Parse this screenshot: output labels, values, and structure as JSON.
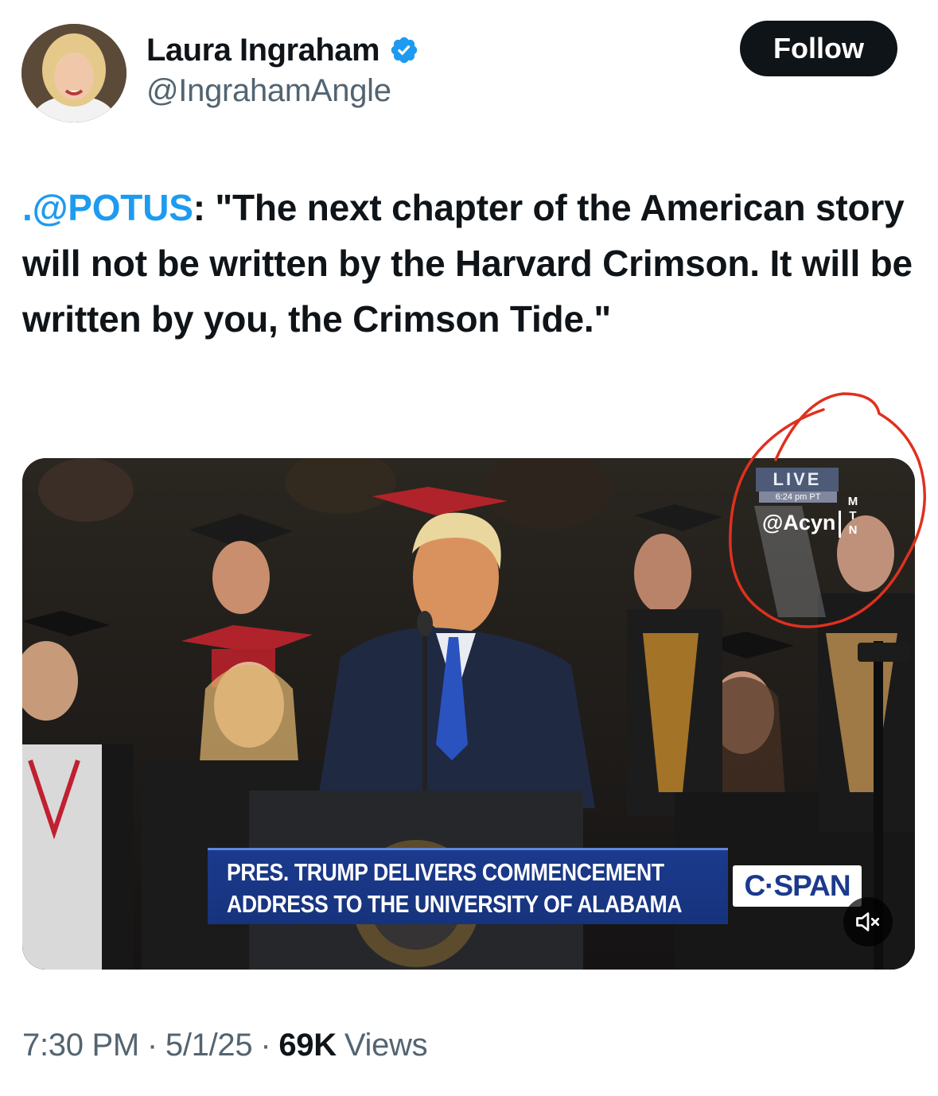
{
  "author": {
    "display_name": "Laura Ingraham",
    "handle": "@IngrahamAngle",
    "verified": true,
    "avatar_icon": "profile-photo"
  },
  "follow_button": {
    "label": "Follow"
  },
  "tweet": {
    "mention": ".@POTUS",
    "text": ": \"The next chapter of the American story will not be written by the Harvard Crimson. It will be written by you, the Crimson Tide.\""
  },
  "media": {
    "chyron_line1": "PRES. TRUMP DELIVERS COMMENCEMENT",
    "chyron_line2": "ADDRESS TO THE UNIVERSITY OF ALABAMA",
    "network_logo": "C·SPAN",
    "live_label": "LIVE",
    "live_time": "6:24 pm PT",
    "watermark": "@Acyn",
    "watermark_side": [
      "M",
      "T",
      "N"
    ],
    "mute_icon": "speaker-muted-icon",
    "annotation_color": "#e0301e"
  },
  "meta": {
    "time": "7:30 PM",
    "date": "5/1/25",
    "separator": "·",
    "views_count": "69K",
    "views_label": "Views"
  },
  "colors": {
    "accent": "#1d9bf0",
    "text": "#0f1419",
    "secondary": "#536471"
  }
}
